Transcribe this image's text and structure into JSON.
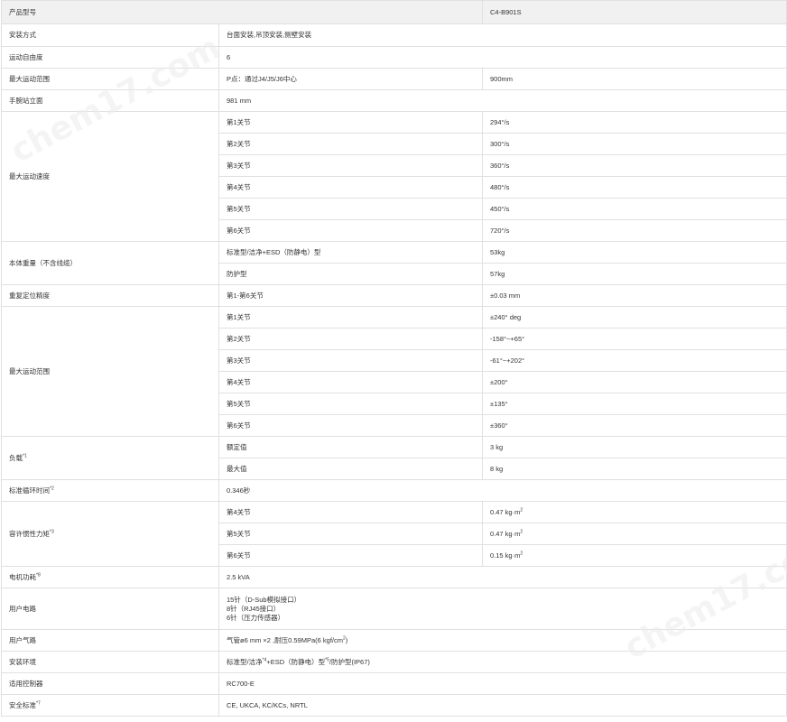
{
  "header": {
    "label": "产品型号",
    "model": "C4-B901S"
  },
  "install": {
    "label": "安装方式",
    "value": "台面安装,吊顶安装,侧壁安装"
  },
  "dof": {
    "label": "运动自由度",
    "value": "6"
  },
  "reach": {
    "label": "最大运动范围",
    "point": "P点：通过J4/J5/J6中心",
    "value": "900mm"
  },
  "arm_height": {
    "label": "手腕站立面",
    "value": "981 mm"
  },
  "speed": {
    "label": "最大运动速度",
    "rows": [
      {
        "joint": "第1关节",
        "value": "294°/s"
      },
      {
        "joint": "第2关节",
        "value": "300°/s"
      },
      {
        "joint": "第3关节",
        "value": "360°/s"
      },
      {
        "joint": "第4关节",
        "value": "480°/s"
      },
      {
        "joint": "第5关节",
        "value": "450°/s"
      },
      {
        "joint": "第6关节",
        "value": "720°/s"
      }
    ]
  },
  "weight": {
    "label": "本体重量（不含线缆）",
    "rows": [
      {
        "type": "标准型/洁净+ESD（防静电）型",
        "value": "53kg"
      },
      {
        "type": "防护型",
        "value": "57kg"
      }
    ]
  },
  "repeat": {
    "label": "重复定位精度",
    "joint": "第1-第6关节",
    "value": "±0.03 mm"
  },
  "range": {
    "label": "最大运动范围",
    "rows": [
      {
        "joint": "第1关节",
        "value": "±240° deg"
      },
      {
        "joint": "第2关节",
        "value": "-158°~+65°"
      },
      {
        "joint": "第3关节",
        "value": "-61°~+202°"
      },
      {
        "joint": "第4关节",
        "value": "±200°"
      },
      {
        "joint": "第5关节",
        "value": "±135°"
      },
      {
        "joint": "第6关节",
        "value": "±360°"
      }
    ]
  },
  "payload": {
    "label": "负载",
    "sup": "*1",
    "rows": [
      {
        "type": "额定值",
        "value": "3 kg"
      },
      {
        "type": "最大值",
        "value": "8 kg"
      }
    ]
  },
  "cycle": {
    "label": "标准循环时间",
    "sup": "*2",
    "value": "0.346秒"
  },
  "inertia": {
    "label": "容许惯性力矩",
    "sup": "*3",
    "unit_sup": "2",
    "rows": [
      {
        "joint": "第4关节",
        "value": "0.47 kg·m"
      },
      {
        "joint": "第5关节",
        "value": "0.47 kg·m"
      },
      {
        "joint": "第6关节",
        "value": "0.15 kg·m"
      }
    ]
  },
  "power": {
    "label": "电机功耗",
    "sup": "*8",
    "value": "2.5 kVA"
  },
  "wiring": {
    "label": "用户电路",
    "lines": [
      "15针（D-Sub模拟接口）",
      "8针（RJ45接口）",
      "6针（压力传感器）"
    ]
  },
  "air": {
    "label": "用户气路",
    "value": "气管ø6 mm ×2 ,耐压0.59MPa(6 kgf/cm",
    "value_sup": "2",
    "value_end": ")"
  },
  "env": {
    "label": "安装环境",
    "part1": "标准型/洁净",
    "sup1": "*4",
    "part2": "+ESD（防静电）型",
    "sup2": "*5",
    "part3": "/防护型(IP67)"
  },
  "controller": {
    "label": "适用控制器",
    "value": "RC700-E"
  },
  "safety": {
    "label": "安全标准",
    "sup": "*7",
    "value": "CE, UKCA, KC/KCs, NRTL"
  },
  "watermark": "chem17.com"
}
